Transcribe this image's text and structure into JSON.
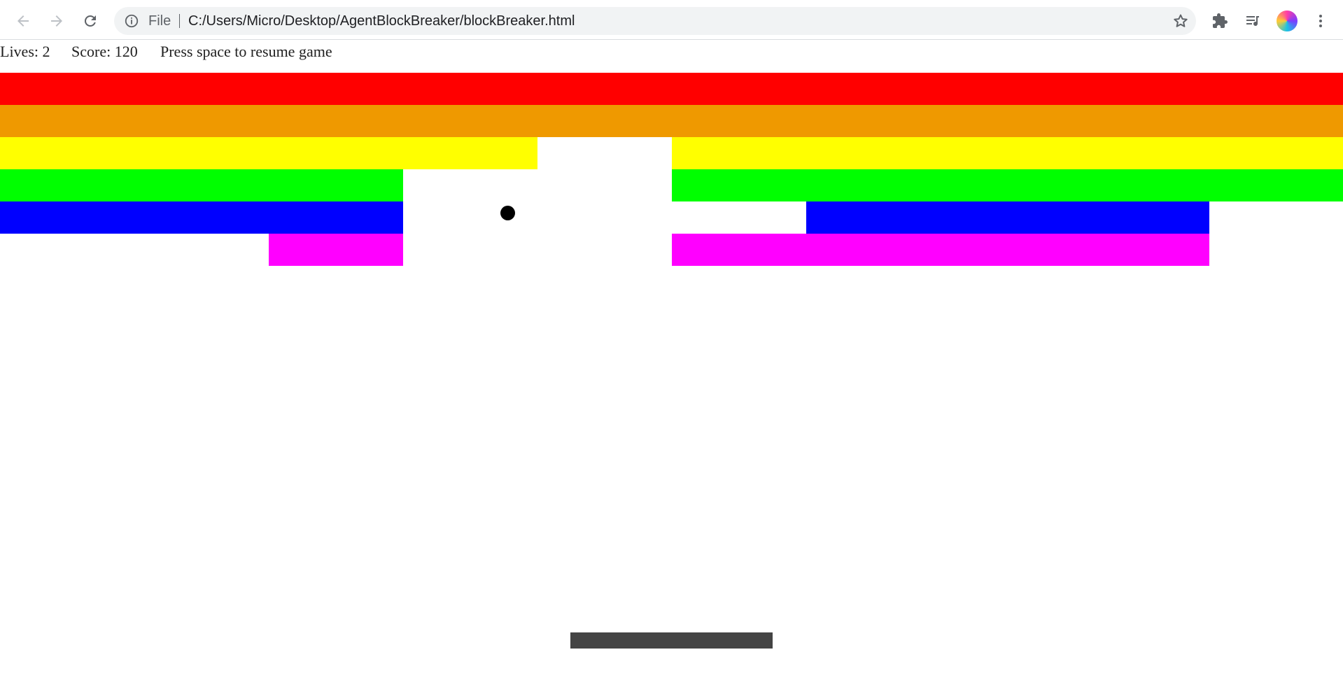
{
  "browser": {
    "omnibox": {
      "scheme_label": "File",
      "url": "C:/Users/Micro/Desktop/AgentBlockBreaker/blockBreaker.html"
    },
    "icons": {
      "back": "arrow-left-icon",
      "forward": "arrow-right-icon",
      "reload": "reload-icon",
      "site_info": "info-icon",
      "bookmark": "star-icon",
      "extensions": "puzzle-icon",
      "media": "playlist-icon",
      "menu": "kebab-menu-icon"
    }
  },
  "game": {
    "lives": "Lives: 2",
    "score": "Score: 120",
    "message": "Press space to resume game",
    "row_colors": [
      "#ff0000",
      "#ef9900",
      "#ffff00",
      "#00ff00",
      "#0000ff",
      "#ff00ff"
    ],
    "paddle_color": "#444444",
    "ball_color": "#000000"
  }
}
